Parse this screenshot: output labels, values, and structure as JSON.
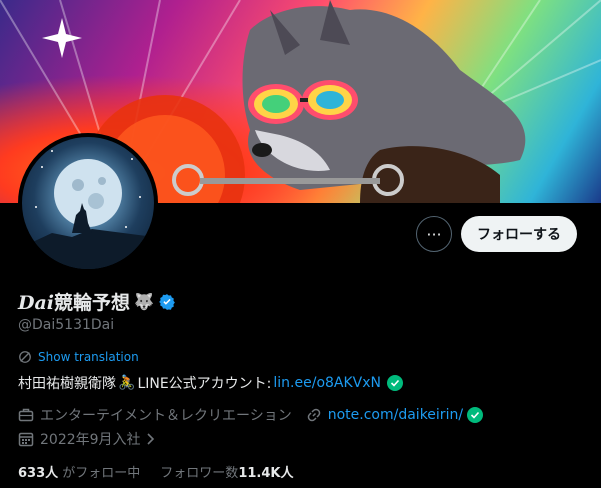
{
  "profile": {
    "display_name_prefix": "Dai",
    "display_name_rest": "競輪予想",
    "name_emoji": "🐺",
    "handle": "@Dai5131Dai",
    "show_translation": "Show translation",
    "bio_text": "村田祐樹親衛隊",
    "bio_emoji": "🚴",
    "bio_line_text": " LINE公式アカウント:",
    "bio_link": "lin.ee/o8AKVxN",
    "category": "エンターテイメント＆レクリエーション",
    "website": "note.com/daikeirin/",
    "joined": "2022年9月入社",
    "following_count": "633人",
    "following_label": "がフォロー中",
    "followers_label": "フォロワー数",
    "followers_count": "11.4K人"
  },
  "actions": {
    "more_label": "···",
    "follow_label": "フォローする"
  },
  "colors": {
    "accent": "#1d9bf0",
    "verified_blue": "#1d9bf0",
    "check_green": "#00ba7c",
    "muted": "#71767b"
  }
}
